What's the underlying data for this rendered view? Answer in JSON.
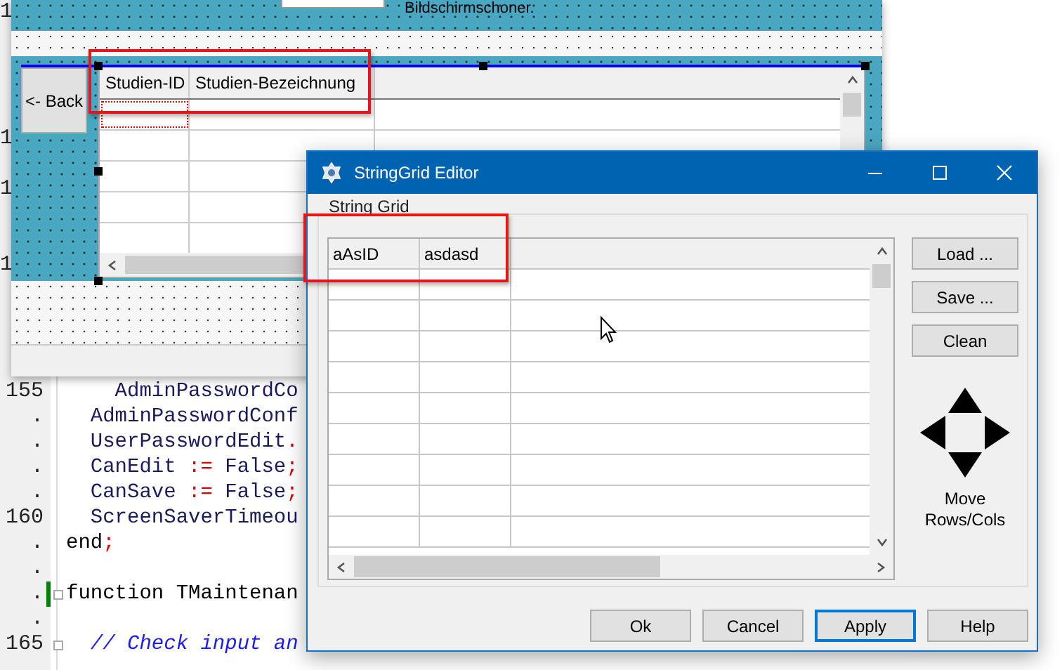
{
  "code_editor": {
    "partial_numbers": [
      "1",
      "1",
      "1",
      "1"
    ],
    "lines": [
      {
        "number": "155",
        "segments": [
          {
            "text": "    AdminPasswordCo",
            "kind": "ident"
          }
        ]
      },
      {
        "number": ".",
        "segments": [
          {
            "text": "  AdminPasswordConf",
            "kind": "ident"
          }
        ]
      },
      {
        "number": ".",
        "segments": [
          {
            "text": "  UserPasswordEdit",
            "kind": "ident"
          },
          {
            "text": ".",
            "kind": "symbol"
          }
        ]
      },
      {
        "number": ".",
        "segments": [
          {
            "text": "  CanEdit ",
            "kind": "ident"
          },
          {
            "text": ":=",
            "kind": "symbol"
          },
          {
            "text": " False",
            "kind": "ident"
          },
          {
            "text": ";",
            "kind": "symbol"
          }
        ]
      },
      {
        "number": ".",
        "segments": [
          {
            "text": "  CanSave ",
            "kind": "ident"
          },
          {
            "text": ":=",
            "kind": "symbol"
          },
          {
            "text": " False",
            "kind": "ident"
          },
          {
            "text": ";",
            "kind": "symbol"
          }
        ]
      },
      {
        "number": "160",
        "segments": [
          {
            "text": "  ScreenSaverTimeou",
            "kind": "ident"
          }
        ]
      },
      {
        "number": ".",
        "segments": [
          {
            "text": "end",
            "kind": "keyword"
          },
          {
            "text": ";",
            "kind": "symbol"
          }
        ]
      },
      {
        "number": "."
      },
      {
        "number": ".",
        "segments": [
          {
            "text": "function TMaintenan",
            "kind": "keyword"
          }
        ],
        "modified": true,
        "foldable": true
      },
      {
        "number": "."
      },
      {
        "number": "165",
        "segments": [
          {
            "text": "  // Check input an",
            "kind": "comment"
          }
        ],
        "foldable": true
      }
    ]
  },
  "designer": {
    "caption": "Bildschirmschoner.",
    "back_button": "<- Back",
    "grid": {
      "columns": [
        "Studien-ID",
        "Studien-Bezeichnung"
      ],
      "rows": [
        {
          "focused": true
        },
        {
          "focused": false
        },
        {
          "focused": false
        },
        {
          "focused": false
        },
        {
          "focused": false
        }
      ]
    }
  },
  "dialog": {
    "title": "StringGrid Editor",
    "group_label": "String Grid",
    "grid": {
      "columns": [
        "aAsID",
        "asdasd"
      ]
    },
    "side_buttons": [
      "Load ...",
      "Save ...",
      "Clean"
    ],
    "move_label": "Move Rows/Cols",
    "buttons": [
      {
        "label": "Ok",
        "default": false
      },
      {
        "label": "Cancel",
        "default": false
      },
      {
        "label": "Apply",
        "default": true
      },
      {
        "label": "Help",
        "default": false
      }
    ]
  }
}
